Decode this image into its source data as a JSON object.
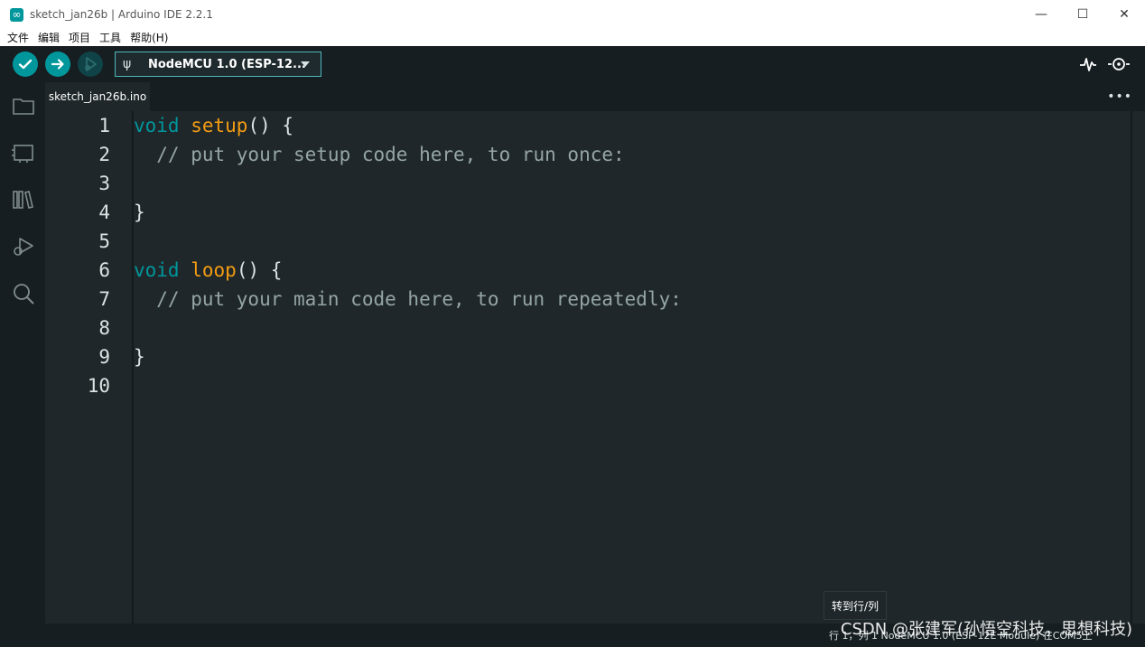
{
  "window": {
    "title": "sketch_jan26b | Arduino IDE 2.2.1",
    "minimize_glyph": "—",
    "maximize_glyph": "☐",
    "close_glyph": "✕"
  },
  "menu": [
    "文件",
    "编辑",
    "项目",
    "工具",
    "帮助(H)"
  ],
  "toolbar": {
    "board_label": "NodeMCU 1.0 (ESP-12...",
    "usb_glyph": "ψ"
  },
  "tabs": [
    {
      "label": "sketch_jan26b.ino"
    }
  ],
  "more_glyph": "•••",
  "code": {
    "lines": [
      {
        "n": "1",
        "parts": [
          {
            "t": "void",
            "c": "kw"
          },
          {
            "t": " ",
            "c": "punc"
          },
          {
            "t": "setup",
            "c": "fn"
          },
          {
            "t": "() {",
            "c": "punc"
          }
        ]
      },
      {
        "n": "2",
        "parts": [
          {
            "t": "  // put your setup code here, to run once:",
            "c": "cm"
          }
        ]
      },
      {
        "n": "3",
        "parts": []
      },
      {
        "n": "4",
        "parts": [
          {
            "t": "}",
            "c": "punc"
          }
        ]
      },
      {
        "n": "5",
        "parts": []
      },
      {
        "n": "6",
        "parts": [
          {
            "t": "void",
            "c": "kw"
          },
          {
            "t": " ",
            "c": "punc"
          },
          {
            "t": "loop",
            "c": "fn"
          },
          {
            "t": "() {",
            "c": "punc"
          }
        ]
      },
      {
        "n": "7",
        "parts": [
          {
            "t": "  // put your main code here, to run repeatedly:",
            "c": "cm"
          }
        ]
      },
      {
        "n": "8",
        "parts": []
      },
      {
        "n": "9",
        "parts": [
          {
            "t": "}",
            "c": "punc"
          }
        ]
      },
      {
        "n": "10",
        "parts": []
      }
    ]
  },
  "tooltip": "转到行/列",
  "status": "行 1，列 1   NodeMCU 1.0 (ESP-12E Module) 在COM5上",
  "watermark": "CSDN @张建军(孙悟空科技，思想科技)",
  "colors": {
    "accent": "#00979c",
    "background": "#171e21",
    "editor": "#1f272a",
    "keyword": "#00979d",
    "function": "#f39c12",
    "comment": "#95a5a6"
  }
}
